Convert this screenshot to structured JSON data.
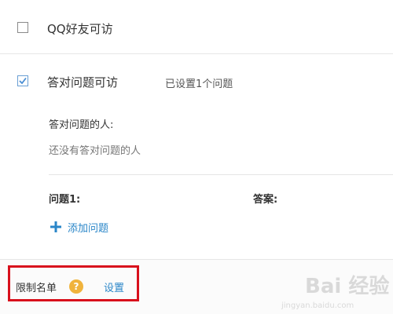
{
  "options": [
    {
      "label": "QQ好友可访",
      "checked": false
    },
    {
      "label": "答对问题可访",
      "checked": true,
      "status": "已设置1个问题"
    }
  ],
  "answerers": {
    "title": "答对问题的人:",
    "empty": "还没有答对问题的人"
  },
  "qa_table": {
    "question_header": "问题1:",
    "answer_header": "答案:"
  },
  "add_question_label": "添加问题",
  "restriction": {
    "label": "限制名单",
    "help_glyph": "?",
    "set_link": "设置"
  },
  "watermark": {
    "brand": "Bai 经验",
    "url": "jingyan.baidu.com"
  },
  "colors": {
    "link": "#2a86c8",
    "help_badge": "#f0b33c",
    "highlight_box": "#d8101c",
    "check_mark": "#4a8fd4"
  }
}
